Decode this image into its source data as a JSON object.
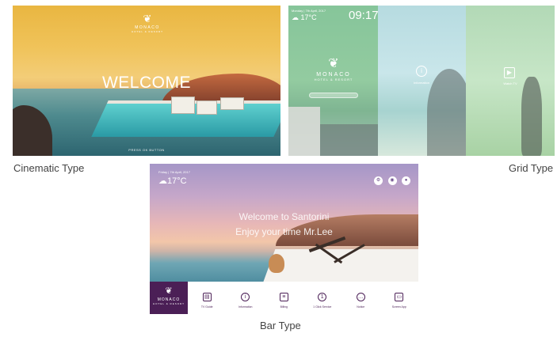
{
  "cinematic": {
    "caption": "Cinematic Type",
    "logo": {
      "name": "MONACO",
      "sub": "HOTEL & RESORT"
    },
    "welcome": "WELCOME",
    "hint": "PRESS OK BUTTON"
  },
  "grid": {
    "caption": "Grid Type",
    "date": "Monday | 7th April, 2017",
    "temperature": "17°C",
    "time": "09:17",
    "logo": {
      "name": "MONACO",
      "sub": "HOTEL & RESORT"
    },
    "tiles": [
      {
        "label": "Information",
        "icon": "info-icon"
      },
      {
        "label": "Watch TV",
        "icon": "play-icon"
      }
    ]
  },
  "bar": {
    "caption": "Bar Type",
    "date": "Friday | 7th April, 2017",
    "temperature": "17°C",
    "welcome_line1": "Welcome to Santorini",
    "welcome_line2": "Enjoy your time Mr.Lee",
    "logo": {
      "name": "MONACO",
      "sub": "HOTEL & RESORT"
    },
    "menu": [
      {
        "label": "TV Guide",
        "icon": "tv-guide-icon"
      },
      {
        "label": "Information",
        "icon": "info-icon"
      },
      {
        "label": "Billing",
        "icon": "billing-icon"
      },
      {
        "label": "1 Click Service",
        "icon": "service-icon"
      },
      {
        "label": "Notice",
        "icon": "notice-icon"
      },
      {
        "label": "Screen App",
        "icon": "screen-app-icon"
      }
    ]
  }
}
